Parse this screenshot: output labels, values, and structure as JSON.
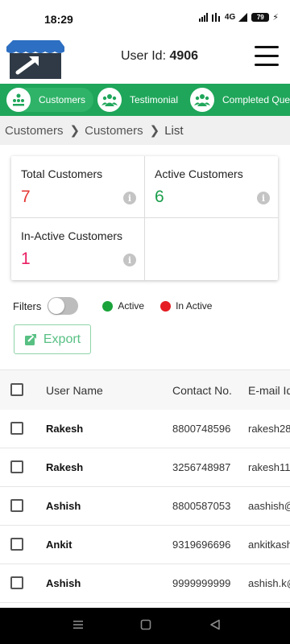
{
  "status_bar": {
    "time": "18:29",
    "battery": "79",
    "network": "4G"
  },
  "header": {
    "user_id_label": "User Id:",
    "user_id_value": "4906"
  },
  "tabs": [
    {
      "label": "Customers",
      "icon": "tree-icon",
      "active": true
    },
    {
      "label": "Testimonial",
      "icon": "people-icon",
      "active": false
    },
    {
      "label": "Completed Query",
      "icon": "people-icon",
      "active": false
    }
  ],
  "breadcrumb": [
    "Customers",
    "Customers",
    "List"
  ],
  "stats": {
    "total": {
      "label": "Total Customers",
      "value": "7",
      "color": "#e53935"
    },
    "active": {
      "label": "Active Customers",
      "value": "6",
      "color": "#1a9e4b"
    },
    "inactive": {
      "label": "In-Active Customers",
      "value": "1",
      "color": "#e91e63"
    }
  },
  "filters": {
    "label": "Filters",
    "active_label": "Active",
    "inactive_label": "In Active",
    "active_color": "#1aa33a",
    "inactive_color": "#e51c23"
  },
  "export_label": "Export",
  "table": {
    "headers": {
      "name": "User Name",
      "contact": "Contact No.",
      "email": "E-mail Id"
    },
    "rows": [
      {
        "name": "Rakesh",
        "contact": "8800748596",
        "email": "rakesh28"
      },
      {
        "name": "Rakesh",
        "contact": "3256748987",
        "email": "rakesh11"
      },
      {
        "name": "Ashish",
        "contact": "8800587053",
        "email": "aashish@"
      },
      {
        "name": "Ankit",
        "contact": "9319696696",
        "email": "ankitkash"
      },
      {
        "name": "Ashish",
        "contact": "9999999999",
        "email": "ashish.k@"
      }
    ]
  },
  "colors": {
    "brand_green": "#1fa65a",
    "accent_green": "#58c083"
  }
}
